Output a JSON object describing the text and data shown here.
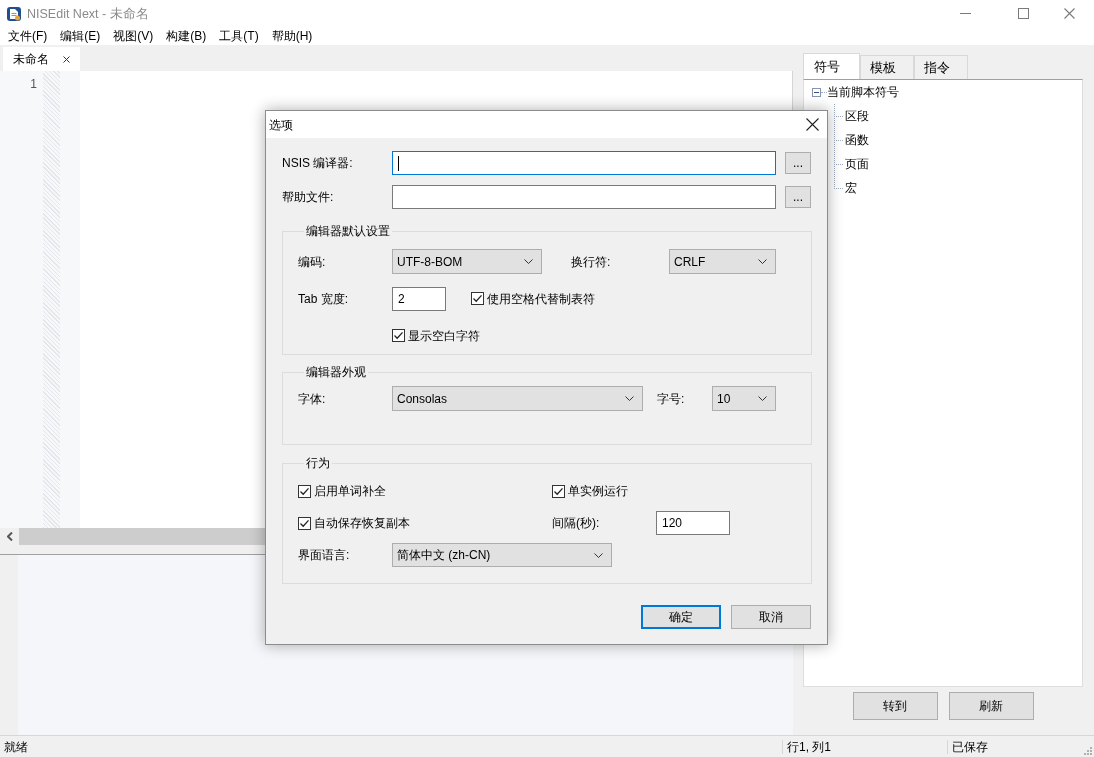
{
  "window": {
    "title": "NISEdit Next - 未命名"
  },
  "menu": [
    "文件(F)",
    "编辑(E)",
    "视图(V)",
    "构建(B)",
    "工具(T)",
    "帮助(H)"
  ],
  "editor_tabs": [
    {
      "label": "未命名",
      "selected": true
    }
  ],
  "editor": {
    "line_numbers": [
      "1"
    ]
  },
  "side_panel": {
    "tabs": [
      {
        "label": "符号",
        "selected": true
      },
      {
        "label": "模板",
        "selected": false
      },
      {
        "label": "指令",
        "selected": false
      }
    ],
    "tree": [
      {
        "label": "当前脚本符号",
        "expanded": true,
        "children": [
          {
            "label": "区段"
          },
          {
            "label": "函数"
          },
          {
            "label": "页面"
          },
          {
            "label": "宏"
          }
        ]
      }
    ],
    "buttons": [
      "转到",
      "刷新"
    ]
  },
  "status_bar": [
    "就绪",
    "行1, 列1",
    "已保存"
  ],
  "dialog": {
    "title": "选项",
    "fields": [
      {
        "label": "NSIS 编译器:",
        "focused": true,
        "button": "..."
      },
      {
        "label": "帮助文件:",
        "focused": false,
        "button": "..."
      }
    ],
    "groups": [
      {
        "title": "编辑器默认设置",
        "rows": [
          {
            "items": [
              {
                "kind": "label",
                "text": "编码:"
              },
              {
                "kind": "dropdown",
                "value": "UTF-8-BOM"
              },
              {
                "kind": "label",
                "text": "换行符:"
              },
              {
                "kind": "dropdown",
                "value": "CRLF"
              }
            ]
          },
          {
            "items": [
              {
                "kind": "label",
                "text": "Tab 宽度:"
              },
              {
                "kind": "input",
                "value": "2"
              },
              {
                "kind": "checkbox",
                "label": "使用空格代替制表符",
                "checked": true
              }
            ]
          },
          {
            "items": [
              {
                "kind": "checkbox",
                "label": "显示空白字符",
                "checked": true
              }
            ]
          }
        ]
      },
      {
        "title": "编辑器外观",
        "rows": [
          {
            "items": [
              {
                "kind": "label",
                "text": "字体:"
              },
              {
                "kind": "dropdown",
                "value": "Consolas"
              },
              {
                "kind": "label",
                "text": "字号:"
              },
              {
                "kind": "dropdown",
                "value": "10"
              }
            ]
          }
        ]
      },
      {
        "title": "行为",
        "rows": [
          {
            "items": [
              {
                "kind": "checkbox",
                "label": "启用单词补全",
                "checked": true
              },
              {
                "kind": "checkbox",
                "label": "单实例运行",
                "checked": true
              }
            ]
          },
          {
            "items": [
              {
                "kind": "checkbox",
                "label": "自动保存恢复副本",
                "checked": true
              },
              {
                "kind": "label",
                "text": "间隔(秒):"
              },
              {
                "kind": "input",
                "value": "120"
              }
            ]
          },
          {
            "items": [
              {
                "kind": "label",
                "text": "界面语言:"
              },
              {
                "kind": "dropdown",
                "value": "简体中文 (zh-CN)"
              }
            ]
          }
        ]
      }
    ],
    "buttons": [
      {
        "label": "确定",
        "default": true
      },
      {
        "label": "取消",
        "default": false
      }
    ]
  }
}
